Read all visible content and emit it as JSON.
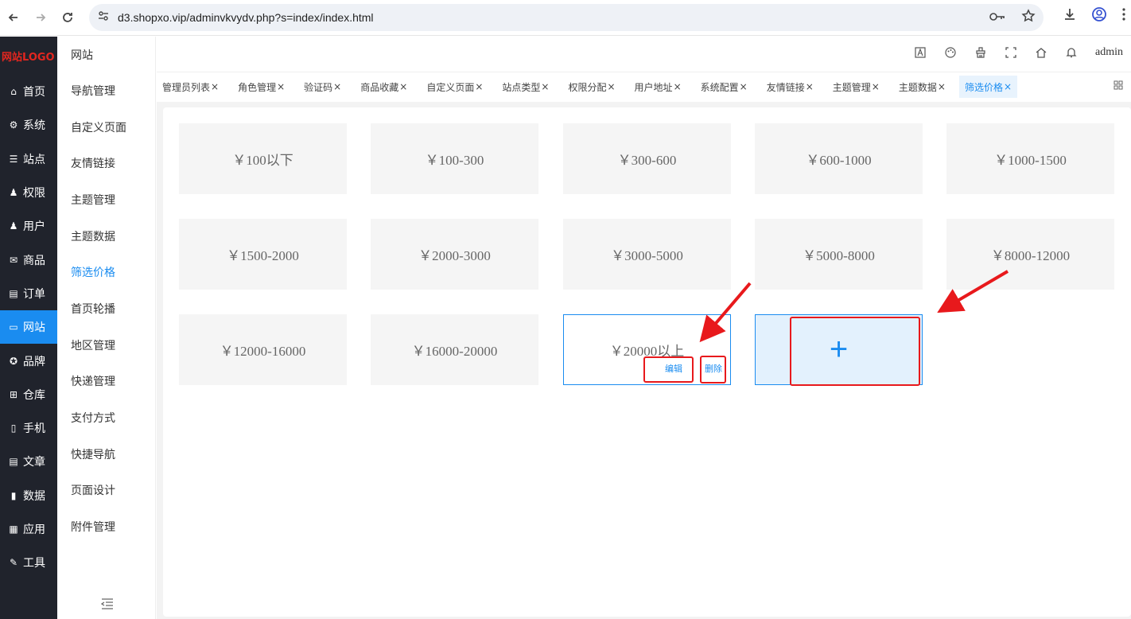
{
  "browser": {
    "url": "d3.shopxo.vip/adminvkvydv.php?s=index/index.html"
  },
  "sidebar": {
    "logo": "网站LOGO",
    "items": [
      {
        "label": "首页",
        "icon": "home-icon"
      },
      {
        "label": "系统",
        "icon": "gear-icon"
      },
      {
        "label": "站点",
        "icon": "sliders-icon"
      },
      {
        "label": "权限",
        "icon": "user-lock-icon"
      },
      {
        "label": "用户",
        "icon": "user-icon"
      },
      {
        "label": "商品",
        "icon": "mail-icon"
      },
      {
        "label": "订单",
        "icon": "document-icon"
      },
      {
        "label": "网站",
        "icon": "monitor-icon"
      },
      {
        "label": "品牌",
        "icon": "award-icon"
      },
      {
        "label": "仓库",
        "icon": "sitemap-icon"
      },
      {
        "label": "手机",
        "icon": "phone-icon"
      },
      {
        "label": "文章",
        "icon": "article-icon"
      },
      {
        "label": "数据",
        "icon": "bar-chart-icon"
      },
      {
        "label": "应用",
        "icon": "grid-icon"
      },
      {
        "label": "工具",
        "icon": "wrench-icon"
      }
    ],
    "active_index": 7
  },
  "subsidebar": {
    "title": "网站",
    "items": [
      "导航管理",
      "自定义页面",
      "友情链接",
      "主题管理",
      "主题数据",
      "筛选价格",
      "首页轮播",
      "地区管理",
      "快递管理",
      "支付方式",
      "快捷导航",
      "页面设计",
      "附件管理"
    ],
    "active": "筛选价格"
  },
  "topbar": {
    "user": "admin"
  },
  "tabs": {
    "items": [
      "管理员列表",
      "角色管理",
      "验证码",
      "商品收藏",
      "自定义页面",
      "站点类型",
      "权限分配",
      "用户地址",
      "系统配置",
      "友情链接",
      "主题管理",
      "主题数据",
      "筛选价格"
    ],
    "close": "×",
    "active": "筛选价格"
  },
  "price_cards": [
    "￥100以下",
    "￥100-300",
    "￥300-600",
    "￥600-1000",
    "￥1000-1500",
    "￥1500-2000",
    "￥2000-3000",
    "￥3000-5000",
    "￥5000-8000",
    "￥8000-12000",
    "￥12000-16000",
    "￥16000-20000",
    "￥20000以上"
  ],
  "card_actions": {
    "edit": "编辑",
    "delete": "删除"
  },
  "add_card": {
    "symbol": "+"
  },
  "colors": {
    "accent": "#1a8cf0",
    "sidebar_bg": "#20232c",
    "annotation": "#e8191c"
  }
}
